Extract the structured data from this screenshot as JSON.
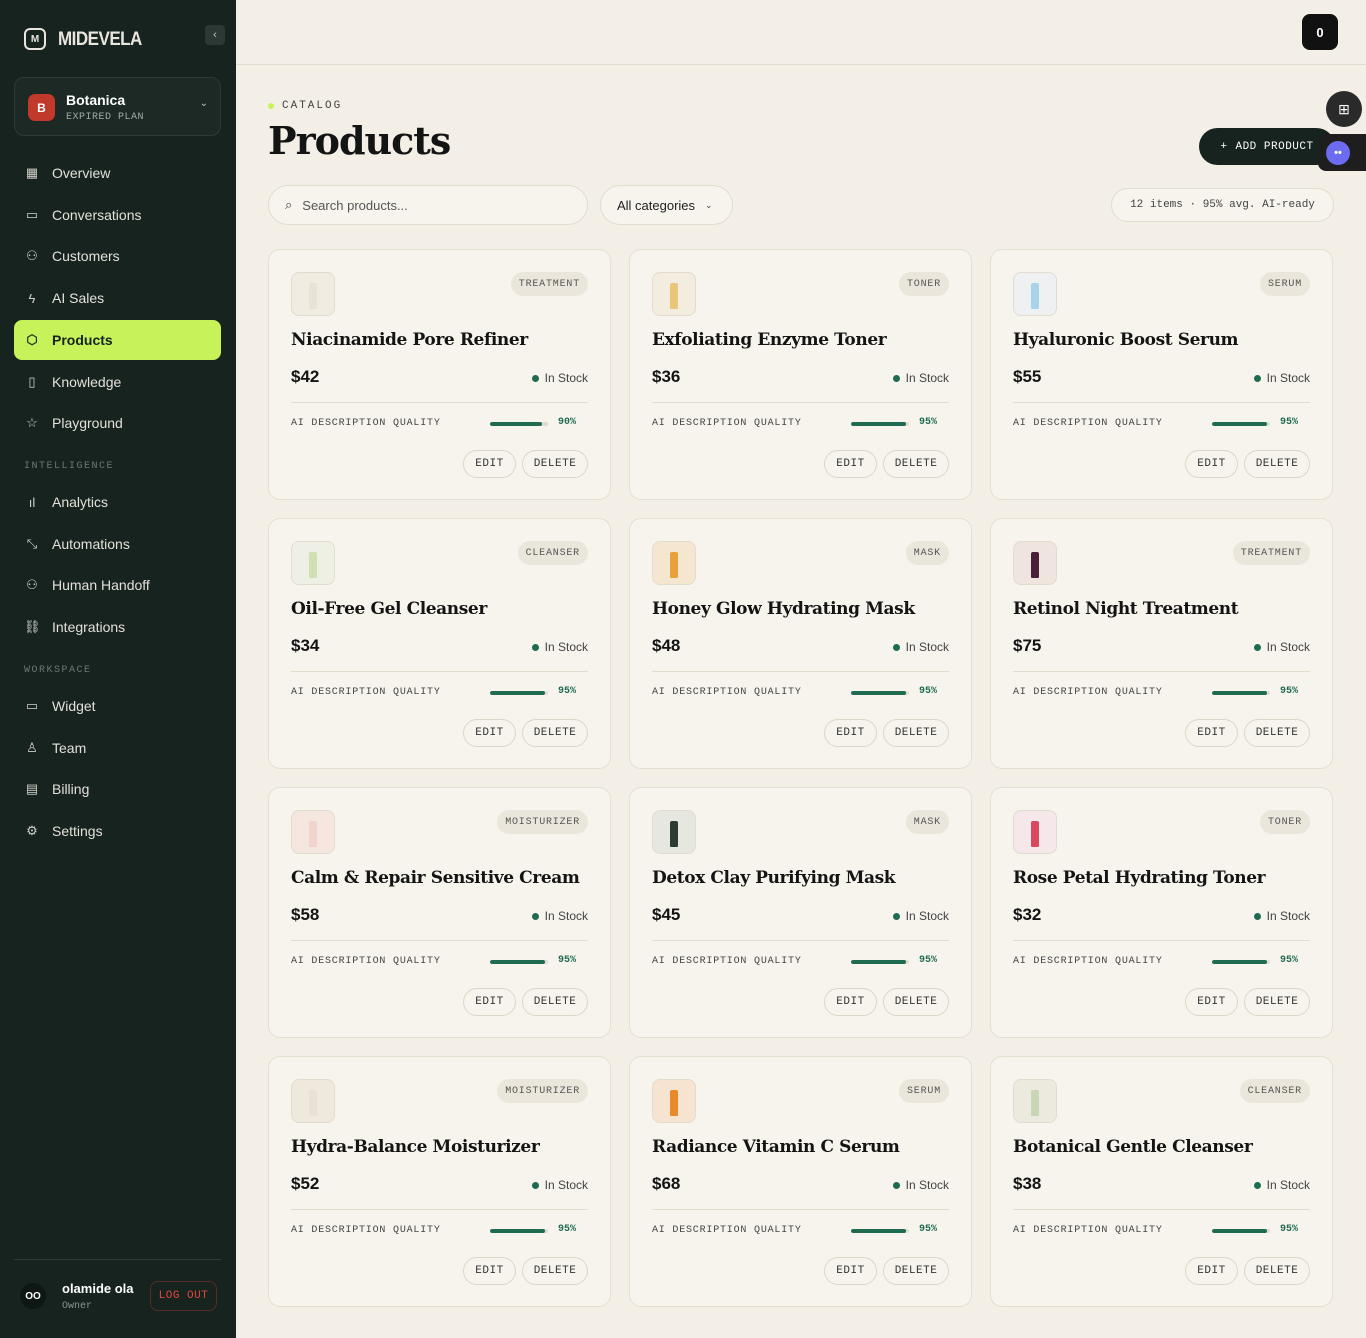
{
  "brand": {
    "name": "MIDEVELA",
    "logo_icon": "midevela-logo-icon"
  },
  "org": {
    "initial": "B",
    "name": "Botanica",
    "plan": "EXPIRED PLAN"
  },
  "nav": {
    "main": [
      {
        "label": "Overview",
        "icon": "▦"
      },
      {
        "label": "Conversations",
        "icon": "▭"
      },
      {
        "label": "Customers",
        "icon": "⚇"
      },
      {
        "label": "AI Sales",
        "icon": "ϟ"
      },
      {
        "label": "Products",
        "icon": "⬡"
      },
      {
        "label": "Knowledge",
        "icon": "▯"
      },
      {
        "label": "Playground",
        "icon": "☆"
      }
    ],
    "intelligence_label": "INTELLIGENCE",
    "intelligence": [
      {
        "label": "Analytics",
        "icon": "ıl"
      },
      {
        "label": "Automations",
        "icon": "⤡"
      },
      {
        "label": "Human Handoff",
        "icon": "⚇"
      },
      {
        "label": "Integrations",
        "icon": "⛓"
      }
    ],
    "workspace_label": "WORKSPACE",
    "workspace": [
      {
        "label": "Widget",
        "icon": "▭"
      },
      {
        "label": "Team",
        "icon": "♙"
      },
      {
        "label": "Billing",
        "icon": "▤"
      },
      {
        "label": "Settings",
        "icon": "⚙"
      }
    ]
  },
  "user": {
    "initials": "OO",
    "name": "olamide ola",
    "role": "Owner",
    "logout": "LOG OUT"
  },
  "topbar": {
    "cart_count": "0"
  },
  "header": {
    "eyebrow": "CATALOG",
    "title": "Products",
    "add_label": "ADD PRODUCT",
    "add_icon": "+"
  },
  "search": {
    "placeholder": "Search products..."
  },
  "filter": {
    "value": "All categories"
  },
  "summary": "12 items · 95% avg. AI-ready",
  "card_labels": {
    "stock": "In Stock",
    "quality": "AI DESCRIPTION QUALITY",
    "edit": "EDIT",
    "delete": "DELETE"
  },
  "colors": {
    "accent": "#c8f25a",
    "sidebar": "#17231f",
    "stock": "#1f6b52"
  },
  "products": [
    {
      "name": "Niacinamide Pore Refiner",
      "category": "TREATMENT",
      "price": "$42",
      "quality": 90,
      "quality_label": "90%",
      "thumb": "#f1ece2",
      "bottle": "#e8e3d6"
    },
    {
      "name": "Exfoliating Enzyme Toner",
      "category": "TONER",
      "price": "$36",
      "quality": 95,
      "quality_label": "95%",
      "thumb": "#f3ede0",
      "bottle": "#e9c77a"
    },
    {
      "name": "Hyaluronic Boost Serum",
      "category": "SERUM",
      "price": "$55",
      "quality": 95,
      "quality_label": "95%",
      "thumb": "#eef0f2",
      "bottle": "#a9d3e8"
    },
    {
      "name": "Oil-Free Gel Cleanser",
      "category": "CLEANSER",
      "price": "$34",
      "quality": 95,
      "quality_label": "95%",
      "thumb": "#eef0e6",
      "bottle": "#cfe0b5"
    },
    {
      "name": "Honey Glow Hydrating Mask",
      "category": "MASK",
      "price": "$48",
      "quality": 95,
      "quality_label": "95%",
      "thumb": "#f5e6cf",
      "bottle": "#e9a23b"
    },
    {
      "name": "Retinol Night Treatment",
      "category": "TREATMENT",
      "price": "$75",
      "quality": 95,
      "quality_label": "95%",
      "thumb": "#efe4de",
      "bottle": "#4a1f3a"
    },
    {
      "name": "Calm & Repair Sensitive Cream",
      "category": "MOISTURIZER",
      "price": "$58",
      "quality": 95,
      "quality_label": "95%",
      "thumb": "#f6e6e0",
      "bottle": "#f2d4cf"
    },
    {
      "name": "Detox Clay Purifying Mask",
      "category": "MASK",
      "price": "$45",
      "quality": 95,
      "quality_label": "95%",
      "thumb": "#e6e8e0",
      "bottle": "#2e3b33"
    },
    {
      "name": "Rose Petal Hydrating Toner",
      "category": "TONER",
      "price": "$32",
      "quality": 95,
      "quality_label": "95%",
      "thumb": "#f6e8ea",
      "bottle": "#d9485f"
    },
    {
      "name": "Hydra-Balance Moisturizer",
      "category": "MOISTURIZER",
      "price": "$52",
      "quality": 95,
      "quality_label": "95%",
      "thumb": "#efe8dc",
      "bottle": "#e8e2d6"
    },
    {
      "name": "Radiance Vitamin C Serum",
      "category": "SERUM",
      "price": "$68",
      "quality": 95,
      "quality_label": "95%",
      "thumb": "#f6e4d0",
      "bottle": "#e8892b"
    },
    {
      "name": "Botanical Gentle Cleanser",
      "category": "CLEANSER",
      "price": "$38",
      "quality": 95,
      "quality_label": "95%",
      "thumb": "#eceade",
      "bottle": "#c9d6b3"
    }
  ]
}
